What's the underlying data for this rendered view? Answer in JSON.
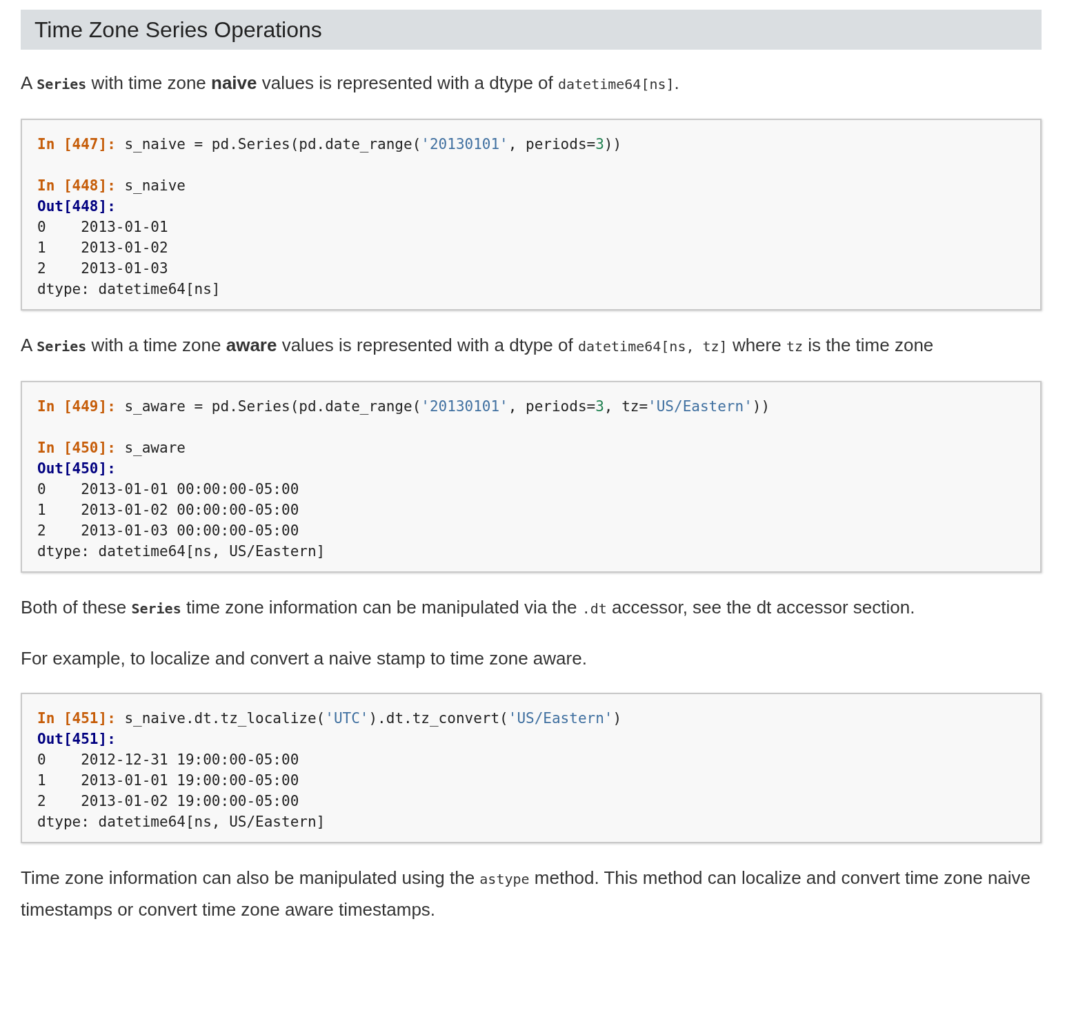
{
  "heading": "Time Zone Series Operations",
  "sections": [
    {
      "kind": "paragraph",
      "segments": [
        {
          "kind": "text",
          "text": "A "
        },
        {
          "kind": "code_bold",
          "text": "Series"
        },
        {
          "kind": "text",
          "text": " with time zone "
        },
        {
          "kind": "bold",
          "text": "naive"
        },
        {
          "kind": "text",
          "text": " values is represented with a dtype of "
        },
        {
          "kind": "code",
          "text": "datetime64[ns]"
        },
        {
          "kind": "text",
          "text": "."
        }
      ]
    },
    {
      "kind": "code_block",
      "cells": [
        [
          {
            "tokens": [
              {
                "kind": "prompt_in",
                "text": "In [447]: "
              },
              {
                "kind": "plain",
                "text": "s_naive = pd.Series(pd.date_range("
              },
              {
                "kind": "string",
                "text": "'20130101'"
              },
              {
                "kind": "plain",
                "text": ", periods="
              },
              {
                "kind": "number",
                "text": "3"
              },
              {
                "kind": "plain",
                "text": "))"
              }
            ]
          }
        ],
        [
          {
            "tokens": [
              {
                "kind": "prompt_in",
                "text": "In [448]: "
              },
              {
                "kind": "plain",
                "text": "s_naive"
              }
            ]
          },
          {
            "tokens": [
              {
                "kind": "prompt_out",
                "text": "Out[448]:"
              }
            ]
          },
          {
            "tokens": [
              {
                "kind": "plain",
                "text": "0    2013-01-01"
              }
            ]
          },
          {
            "tokens": [
              {
                "kind": "plain",
                "text": "1    2013-01-02"
              }
            ]
          },
          {
            "tokens": [
              {
                "kind": "plain",
                "text": "2    2013-01-03"
              }
            ]
          },
          {
            "tokens": [
              {
                "kind": "plain",
                "text": "dtype: datetime64[ns]"
              }
            ]
          }
        ]
      ]
    },
    {
      "kind": "paragraph",
      "segments": [
        {
          "kind": "text",
          "text": "A "
        },
        {
          "kind": "code_bold",
          "text": "Series"
        },
        {
          "kind": "text",
          "text": " with a time zone "
        },
        {
          "kind": "bold",
          "text": "aware"
        },
        {
          "kind": "text",
          "text": " values is represented with a dtype of "
        },
        {
          "kind": "code",
          "text": "datetime64[ns, tz]"
        },
        {
          "kind": "text",
          "text": " where "
        },
        {
          "kind": "code",
          "text": "tz"
        },
        {
          "kind": "text",
          "text": " is the time zone"
        }
      ]
    },
    {
      "kind": "code_block",
      "cells": [
        [
          {
            "tokens": [
              {
                "kind": "prompt_in",
                "text": "In [449]: "
              },
              {
                "kind": "plain",
                "text": "s_aware = pd.Series(pd.date_range("
              },
              {
                "kind": "string",
                "text": "'20130101'"
              },
              {
                "kind": "plain",
                "text": ", periods="
              },
              {
                "kind": "number",
                "text": "3"
              },
              {
                "kind": "plain",
                "text": ", tz="
              },
              {
                "kind": "string",
                "text": "'US/Eastern'"
              },
              {
                "kind": "plain",
                "text": "))"
              }
            ]
          }
        ],
        [
          {
            "tokens": [
              {
                "kind": "prompt_in",
                "text": "In [450]: "
              },
              {
                "kind": "plain",
                "text": "s_aware"
              }
            ]
          },
          {
            "tokens": [
              {
                "kind": "prompt_out",
                "text": "Out[450]:"
              }
            ]
          },
          {
            "tokens": [
              {
                "kind": "plain",
                "text": "0    2013-01-01 00:00:00-05:00"
              }
            ]
          },
          {
            "tokens": [
              {
                "kind": "plain",
                "text": "1    2013-01-02 00:00:00-05:00"
              }
            ]
          },
          {
            "tokens": [
              {
                "kind": "plain",
                "text": "2    2013-01-03 00:00:00-05:00"
              }
            ]
          },
          {
            "tokens": [
              {
                "kind": "plain",
                "text": "dtype: datetime64[ns, US/Eastern]"
              }
            ]
          }
        ]
      ]
    },
    {
      "kind": "paragraph",
      "segments": [
        {
          "kind": "text",
          "text": "Both of these "
        },
        {
          "kind": "code_bold",
          "text": "Series"
        },
        {
          "kind": "text",
          "text": " time zone information can be manipulated via the "
        },
        {
          "kind": "code",
          "text": ".dt"
        },
        {
          "kind": "text",
          "text": " accessor, see the dt accessor section."
        }
      ]
    },
    {
      "kind": "paragraph",
      "segments": [
        {
          "kind": "text",
          "text": "For example, to localize and convert a naive stamp to time zone aware."
        }
      ]
    },
    {
      "kind": "code_block",
      "cells": [
        [
          {
            "tokens": [
              {
                "kind": "prompt_in",
                "text": "In [451]: "
              },
              {
                "kind": "plain",
                "text": "s_naive.dt.tz_localize("
              },
              {
                "kind": "string",
                "text": "'UTC'"
              },
              {
                "kind": "plain",
                "text": ").dt.tz_convert("
              },
              {
                "kind": "string",
                "text": "'US/Eastern'"
              },
              {
                "kind": "plain",
                "text": ")"
              }
            ]
          },
          {
            "tokens": [
              {
                "kind": "prompt_out",
                "text": "Out[451]:"
              }
            ]
          },
          {
            "tokens": [
              {
                "kind": "plain",
                "text": "0    2012-12-31 19:00:00-05:00"
              }
            ]
          },
          {
            "tokens": [
              {
                "kind": "plain",
                "text": "1    2013-01-01 19:00:00-05:00"
              }
            ]
          },
          {
            "tokens": [
              {
                "kind": "plain",
                "text": "2    2013-01-02 19:00:00-05:00"
              }
            ]
          },
          {
            "tokens": [
              {
                "kind": "plain",
                "text": "dtype: datetime64[ns, US/Eastern]"
              }
            ]
          }
        ]
      ]
    },
    {
      "kind": "paragraph",
      "segments": [
        {
          "kind": "text",
          "text": "Time zone information can also be manipulated using the "
        },
        {
          "kind": "code",
          "text": "astype"
        },
        {
          "kind": "text",
          "text": " method. This method can localize and convert time zone naive timestamps or convert time zone aware timestamps."
        }
      ]
    }
  ]
}
